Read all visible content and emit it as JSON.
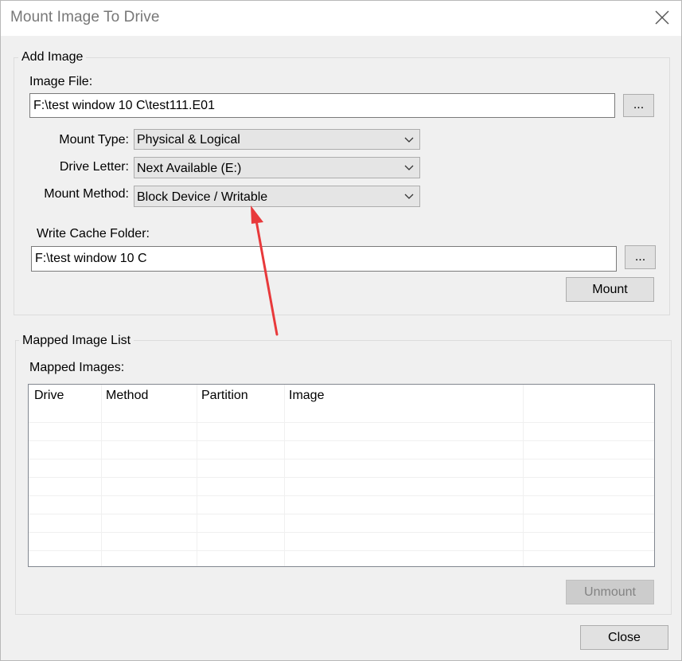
{
  "window": {
    "title": "Mount Image To Drive"
  },
  "add_image": {
    "group_label": "Add Image",
    "image_file_label": "Image File:",
    "image_file_value": "F:\\test window 10 C\\test111.E01",
    "browse_label": "...",
    "mount_type_label": "Mount Type:",
    "mount_type_value": "Physical & Logical",
    "drive_letter_label": "Drive Letter:",
    "drive_letter_value": "Next Available (E:)",
    "mount_method_label": "Mount Method:",
    "mount_method_value": "Block Device / Writable",
    "write_cache_label": "Write Cache Folder:",
    "write_cache_value": "F:\\test window 10 C",
    "cache_browse_label": "...",
    "mount_button": "Mount"
  },
  "mapped": {
    "group_label": "Mapped Image List",
    "list_label": "Mapped Images:",
    "columns": [
      "Drive",
      "Method",
      "Partition",
      "Image"
    ],
    "unmount_button": "Unmount"
  },
  "footer": {
    "close_button": "Close"
  },
  "icons": {
    "close": "close-icon",
    "chevron": "chevron-down-icon"
  },
  "colors": {
    "annotation_arrow": "#e8393b",
    "disabled_text": "#838383"
  }
}
